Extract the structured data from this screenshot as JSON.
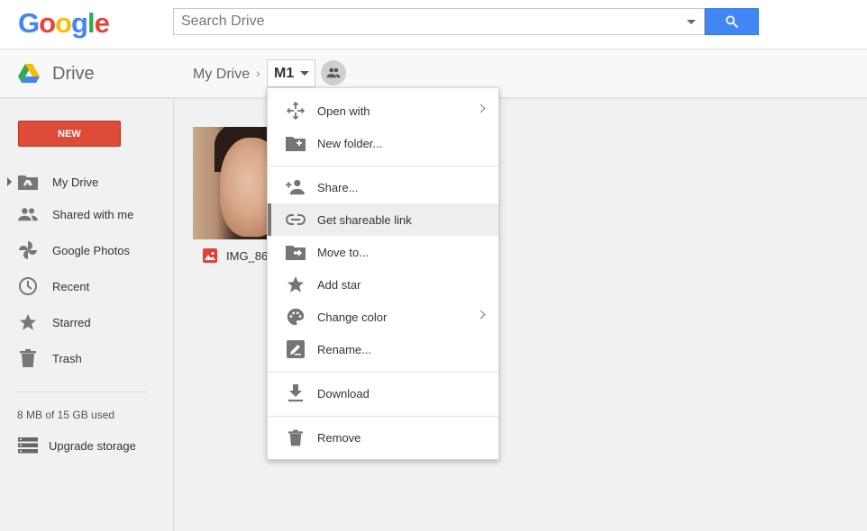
{
  "header": {
    "logo_letters": [
      "G",
      "o",
      "o",
      "g",
      "l",
      "e"
    ],
    "search_placeholder": "Search Drive"
  },
  "subheader": {
    "app_title": "Drive",
    "breadcrumb_root": "My Drive",
    "breadcrumb_separator": "›",
    "breadcrumb_current": "M1"
  },
  "sidebar": {
    "new_label": "NEW",
    "items": [
      {
        "label": "My Drive",
        "icon": "my-drive-icon"
      },
      {
        "label": "Shared with me",
        "icon": "people-icon"
      },
      {
        "label": "Google Photos",
        "icon": "photos-pinwheel-icon"
      },
      {
        "label": "Recent",
        "icon": "clock-icon"
      },
      {
        "label": "Starred",
        "icon": "star-icon"
      },
      {
        "label": "Trash",
        "icon": "trash-icon"
      }
    ],
    "storage_text": "8 MB of 15 GB used",
    "upgrade_label": "Upgrade storage"
  },
  "files": [
    {
      "name": "IMG_86",
      "type": "image"
    }
  ],
  "context_menu": {
    "items": [
      {
        "label": "Open with",
        "icon": "move-arrows-icon",
        "submenu": true
      },
      {
        "label": "New folder...",
        "icon": "folder-plus-icon"
      },
      {
        "label": "Share...",
        "icon": "person-add-icon"
      },
      {
        "label": "Get shareable link",
        "icon": "link-icon",
        "active": true
      },
      {
        "label": "Move to...",
        "icon": "folder-move-icon"
      },
      {
        "label": "Add star",
        "icon": "star-icon"
      },
      {
        "label": "Change color",
        "icon": "palette-icon",
        "submenu": true
      },
      {
        "label": "Rename...",
        "icon": "pencil-icon"
      },
      {
        "label": "Download",
        "icon": "download-icon"
      },
      {
        "label": "Remove",
        "icon": "trash-icon"
      }
    ]
  },
  "colors": {
    "brand_blue": "#4285f4",
    "new_red": "#dd4b39",
    "icon_gray": "#757575"
  }
}
